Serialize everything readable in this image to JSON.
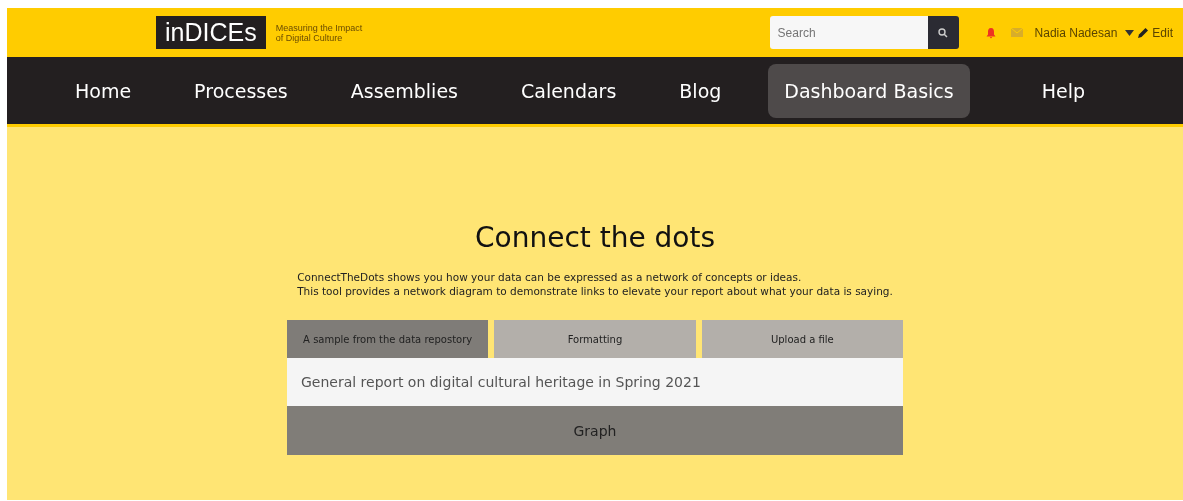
{
  "header": {
    "logo": "inDICEs",
    "tagline_line_1": "Measuring the Impact",
    "tagline_line_2": "of Digital Culture",
    "search": {
      "placeholder": "Search"
    },
    "user": "Nadia Nadesan",
    "edit": "Edit"
  },
  "nav": [
    {
      "label": "Home",
      "selected": false
    },
    {
      "label": "Processes",
      "selected": false
    },
    {
      "label": "Assemblies",
      "selected": false
    },
    {
      "label": "Calendars",
      "selected": false
    },
    {
      "label": "Blog",
      "selected": false
    },
    {
      "label": "Dashboard Basics",
      "selected": true
    },
    {
      "label": "Help",
      "selected": false
    }
  ],
  "main": {
    "title": "Connect the dots",
    "description_line_1": "ConnectTheDots shows you how your data can be expressed as a network of concepts or ideas.",
    "description_line_2": "This tool provides a network diagram to demonstrate links to elevate your report about what your data is saying.",
    "tabs": [
      {
        "label": "A sample from the data repostory",
        "selected": true
      },
      {
        "label": "Formatting",
        "selected": false
      },
      {
        "label": "Upload a file",
        "selected": false
      }
    ],
    "report_field": {
      "value": "General report on digital cultural heritage in Spring 2021"
    },
    "graph_button": "Graph"
  }
}
